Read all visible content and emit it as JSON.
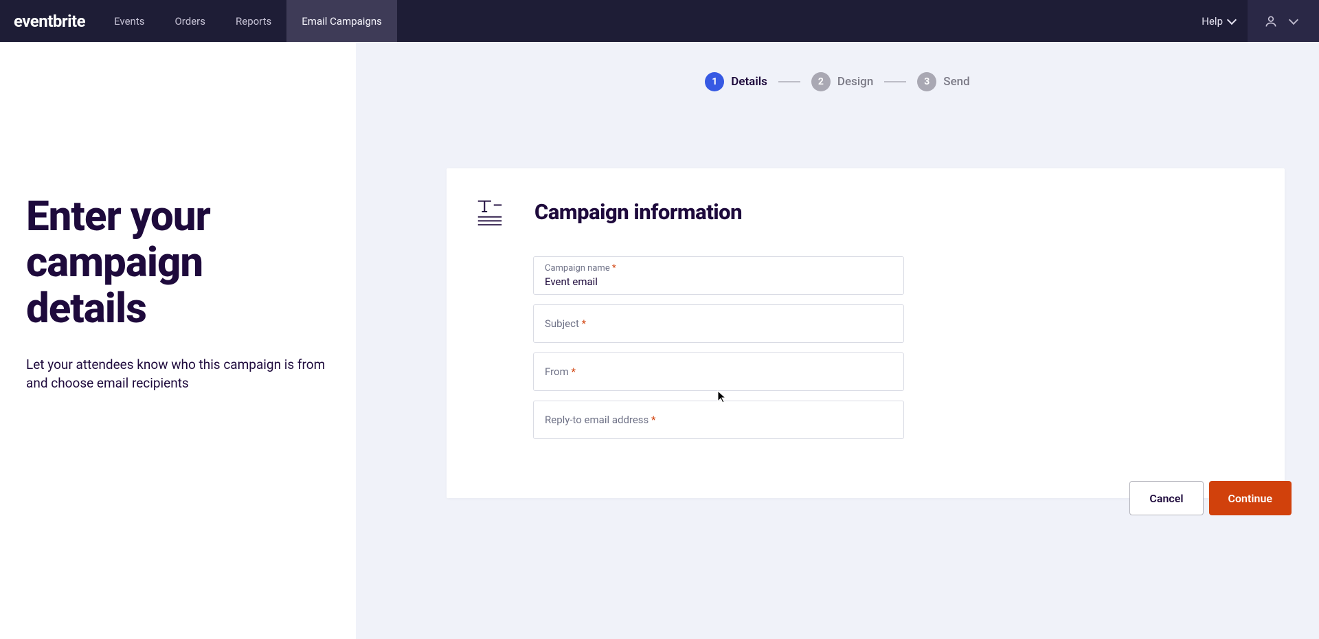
{
  "nav": {
    "brand": "eventbrite",
    "items": [
      "Events",
      "Orders",
      "Reports",
      "Email Campaigns"
    ],
    "active_index": 3,
    "help": "Help"
  },
  "left": {
    "title_line1": "Enter your",
    "title_line2": "campaign",
    "title_line3": "details",
    "subtitle": "Let your attendees know who this campaign is from and choose email recipients"
  },
  "stepper": {
    "steps": [
      {
        "num": "1",
        "label": "Details"
      },
      {
        "num": "2",
        "label": "Design"
      },
      {
        "num": "3",
        "label": "Send"
      }
    ],
    "active_index": 0
  },
  "card": {
    "title": "Campaign information",
    "fields": {
      "campaign_name": {
        "label": "Campaign name",
        "value": "Event email",
        "required": true
      },
      "subject": {
        "label": "Subject",
        "value": "",
        "required": true
      },
      "from": {
        "label": "From",
        "value": "",
        "required": true
      },
      "reply_to": {
        "label": "Reply-to email address",
        "value": "",
        "required": true
      }
    }
  },
  "footer": {
    "cancel": "Cancel",
    "continue": "Continue"
  }
}
